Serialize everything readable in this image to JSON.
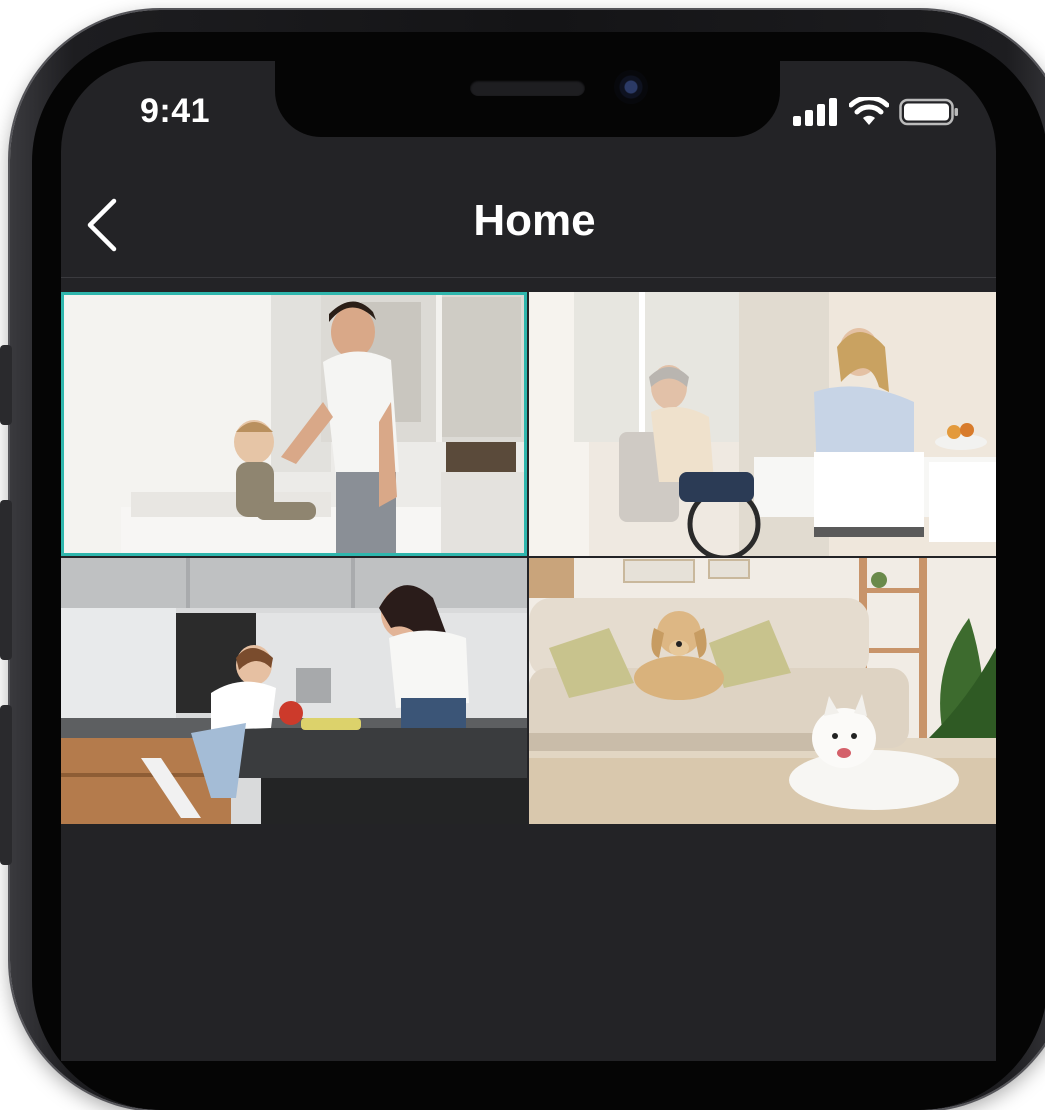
{
  "status_bar": {
    "time": "9:41",
    "icons": [
      "signal-icon",
      "wifi-icon",
      "battery-icon"
    ]
  },
  "header": {
    "back_icon": "chevron-left-icon",
    "title": "Home"
  },
  "camera_grid": {
    "selected_index": 0,
    "accent_color": "#2fb6ad",
    "tiles": [
      {
        "scene": "nursery",
        "selected": true
      },
      {
        "scene": "dining-room",
        "selected": false
      },
      {
        "scene": "kitchen",
        "selected": false
      },
      {
        "scene": "living-room",
        "selected": false
      }
    ]
  },
  "colors": {
    "background": "#232326",
    "text": "#ffffff",
    "accent": "#2fb6ad"
  }
}
